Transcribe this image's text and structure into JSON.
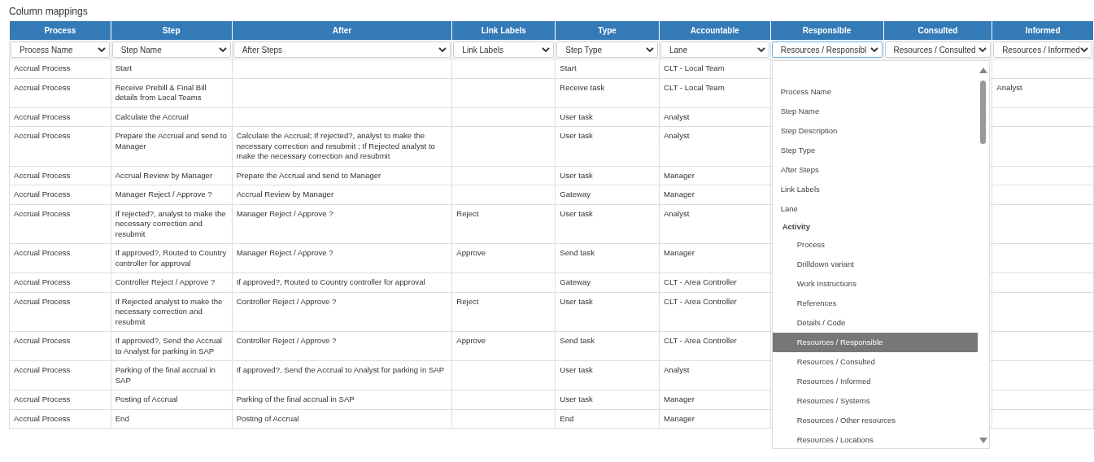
{
  "title": "Column mappings",
  "columns": [
    {
      "header": "Process",
      "mapping": "Process Name",
      "open": false
    },
    {
      "header": "Step",
      "mapping": "Step Name",
      "open": false
    },
    {
      "header": "After",
      "mapping": "After Steps",
      "open": false
    },
    {
      "header": "Link Labels",
      "mapping": "Link Labels",
      "open": false
    },
    {
      "header": "Type",
      "mapping": "Step Type",
      "open": false
    },
    {
      "header": "Accountable",
      "mapping": "Lane",
      "open": false
    },
    {
      "header": "Responsible",
      "mapping": "Resources / Responsibl",
      "open": true
    },
    {
      "header": "Consulted",
      "mapping": "Resources / Consulted",
      "open": false
    },
    {
      "header": "Informed",
      "mapping": "Resources / Informed",
      "open": false
    }
  ],
  "rows": [
    {
      "cells": [
        "Accrual Process",
        "Start",
        null,
        null,
        "Start",
        "CLT - Local Team",
        null,
        null,
        null
      ]
    },
    {
      "cells": [
        "Accrual Process",
        "Receive Prebill & Final Bill details from Local Teams",
        null,
        null,
        "Receive task",
        "CLT - Local Team",
        null,
        null,
        "Analyst"
      ]
    },
    {
      "cells": [
        "Accrual Process",
        "Calculate the Accrual",
        null,
        null,
        "User task",
        "Analyst",
        null,
        null,
        null
      ]
    },
    {
      "cells": [
        "Accrual Process",
        "Prepare the Accrual and send to Manager",
        "Calculate the Accrual; If rejected?, analyst to make the necessary correction and resubmit ; If Rejected analyst to make the necessary correction and resubmit",
        null,
        "User task",
        "Analyst",
        null,
        null,
        null
      ]
    },
    {
      "cells": [
        "Accrual Process",
        "Accrual Review by Manager",
        "Prepare the Accrual and send to Manager",
        null,
        "User task",
        "Manager",
        null,
        null,
        null
      ]
    },
    {
      "cells": [
        "Accrual Process",
        "Manager Reject / Approve ?",
        "Accrual Review by Manager",
        null,
        "Gateway",
        "Manager",
        null,
        null,
        null
      ]
    },
    {
      "cells": [
        "Accrual Process",
        "If rejected?, analyst to make the necessary correction and resubmit",
        "Manager Reject / Approve ?",
        "Reject",
        "User task",
        "Analyst",
        null,
        null,
        null
      ]
    },
    {
      "cells": [
        "Accrual Process",
        "If approved?, Routed to Country controller for approval",
        "Manager Reject / Approve ?",
        "Approve",
        "Send task",
        "Manager",
        null,
        null,
        null
      ]
    },
    {
      "cells": [
        "Accrual Process",
        "Controller Reject / Approve ?",
        "If approved?, Routed to Country controller for approval",
        null,
        "Gateway",
        "CLT - Area Controller",
        null,
        null,
        null
      ]
    },
    {
      "cells": [
        "Accrual Process",
        "If Rejected analyst to make the necessary correction and resubmit",
        "Controller Reject / Approve ?",
        "Reject",
        "User task",
        "CLT - Area Controller",
        null,
        null,
        null
      ]
    },
    {
      "cells": [
        "Accrual Process",
        "If approved?, Send the Accrual to Analyst for parking in SAP",
        "Controller Reject / Approve ?",
        "Approve",
        "Send task",
        "CLT - Area Controller",
        null,
        null,
        null
      ]
    },
    {
      "cells": [
        "Accrual Process",
        "Parking of the final accrual in SAP",
        "If approved?, Send the Accrual to Analyst for parking in SAP",
        null,
        "User task",
        "Analyst",
        null,
        null,
        null
      ]
    },
    {
      "cells": [
        "Accrual Process",
        "Posting of Accrual",
        "Parking of the final accrual in SAP",
        null,
        "User task",
        "Manager",
        null,
        null,
        null
      ]
    },
    {
      "cells": [
        "Accrual Process",
        "End",
        "Posting of Accrual",
        null,
        "End",
        "Manager",
        null,
        null,
        null
      ]
    }
  ],
  "dropdown": {
    "options": [
      {
        "kind": "option",
        "label": "Process Name",
        "selected": false
      },
      {
        "kind": "option",
        "label": "Step Name",
        "selected": false
      },
      {
        "kind": "option",
        "label": "Step Description",
        "selected": false
      },
      {
        "kind": "option",
        "label": "Step Type",
        "selected": false
      },
      {
        "kind": "option",
        "label": "After Steps",
        "selected": false
      },
      {
        "kind": "option",
        "label": "Link Labels",
        "selected": false
      },
      {
        "kind": "option",
        "label": "Lane",
        "selected": false
      },
      {
        "kind": "group",
        "label": "Activity",
        "children": [
          {
            "kind": "option",
            "label": "Process",
            "selected": false
          },
          {
            "kind": "option",
            "label": "Drilldown variant",
            "selected": false
          },
          {
            "kind": "option",
            "label": "Work Instructions",
            "selected": false
          },
          {
            "kind": "option",
            "label": "References",
            "selected": false
          },
          {
            "kind": "option",
            "label": "Details / Code",
            "selected": false
          },
          {
            "kind": "option",
            "label": "Resources / Responsible",
            "selected": true
          },
          {
            "kind": "option",
            "label": "Resources / Consulted",
            "selected": false
          },
          {
            "kind": "option",
            "label": "Resources / Informed",
            "selected": false
          },
          {
            "kind": "option",
            "label": "Resources / Systems",
            "selected": false
          },
          {
            "kind": "option",
            "label": "Resources / Other resources",
            "selected": false
          },
          {
            "kind": "option",
            "label": "Resources / Locations",
            "selected": false
          }
        ]
      }
    ]
  }
}
